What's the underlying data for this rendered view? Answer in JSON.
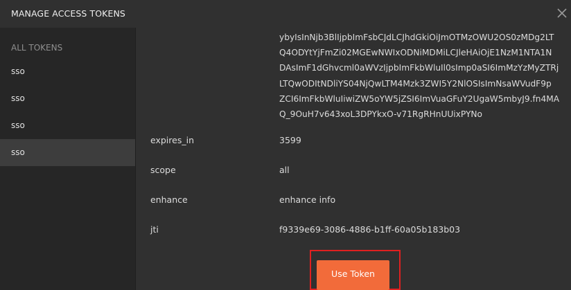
{
  "header": {
    "title": "MANAGE ACCESS TOKENS",
    "close_icon": "close-icon"
  },
  "sidebar": {
    "heading": "ALL TOKENS",
    "items": [
      {
        "label": "sso",
        "selected": false
      },
      {
        "label": "sso",
        "selected": false
      },
      {
        "label": "sso",
        "selected": false
      },
      {
        "label": "sso",
        "selected": true
      }
    ]
  },
  "token": {
    "access_token_lines": [
      "ybyIsInNjb3BlIjpbImFsbCJdLCJhdGkiOiJmOTMzOWU2OS0zMDg2LT",
      "Q4ODYtYjFmZi02MGEwNWIxODNiMDMiLCJleHAiOjE1NzM1NTA1N",
      "DAsImF1dGhvcml0aWVzIjpbImFkbWluIl0sImp0aSI6ImMzYzMyZTRj",
      "LTQwODItNDliYS04NjQwLTM4Mzk3ZWI5Y2NlOSIsImNsaWVudF9p",
      "ZCI6ImFkbWluIiwiZW5oYW5jZSI6ImVuaGFuY2UgaW5mbyJ9.fn4MA",
      "Q_9OuH7v643xoL3DPYkxO-v71RgRHnUUixPYNo"
    ],
    "fields": [
      {
        "key": "expires_in",
        "value": "3599"
      },
      {
        "key": "scope",
        "value": "all"
      },
      {
        "key": "enhance",
        "value": "enhance info"
      },
      {
        "key": "jti",
        "value": "f9339e69-3086-4886-b1ff-60a05b183b03"
      }
    ]
  },
  "actions": {
    "use_token_label": "Use Token"
  },
  "colors": {
    "accent": "#f26b3a",
    "highlight_box": "#e02020",
    "background": "#303030",
    "sidebar": "#262626",
    "sidebar_selected": "#3d3d3d"
  }
}
